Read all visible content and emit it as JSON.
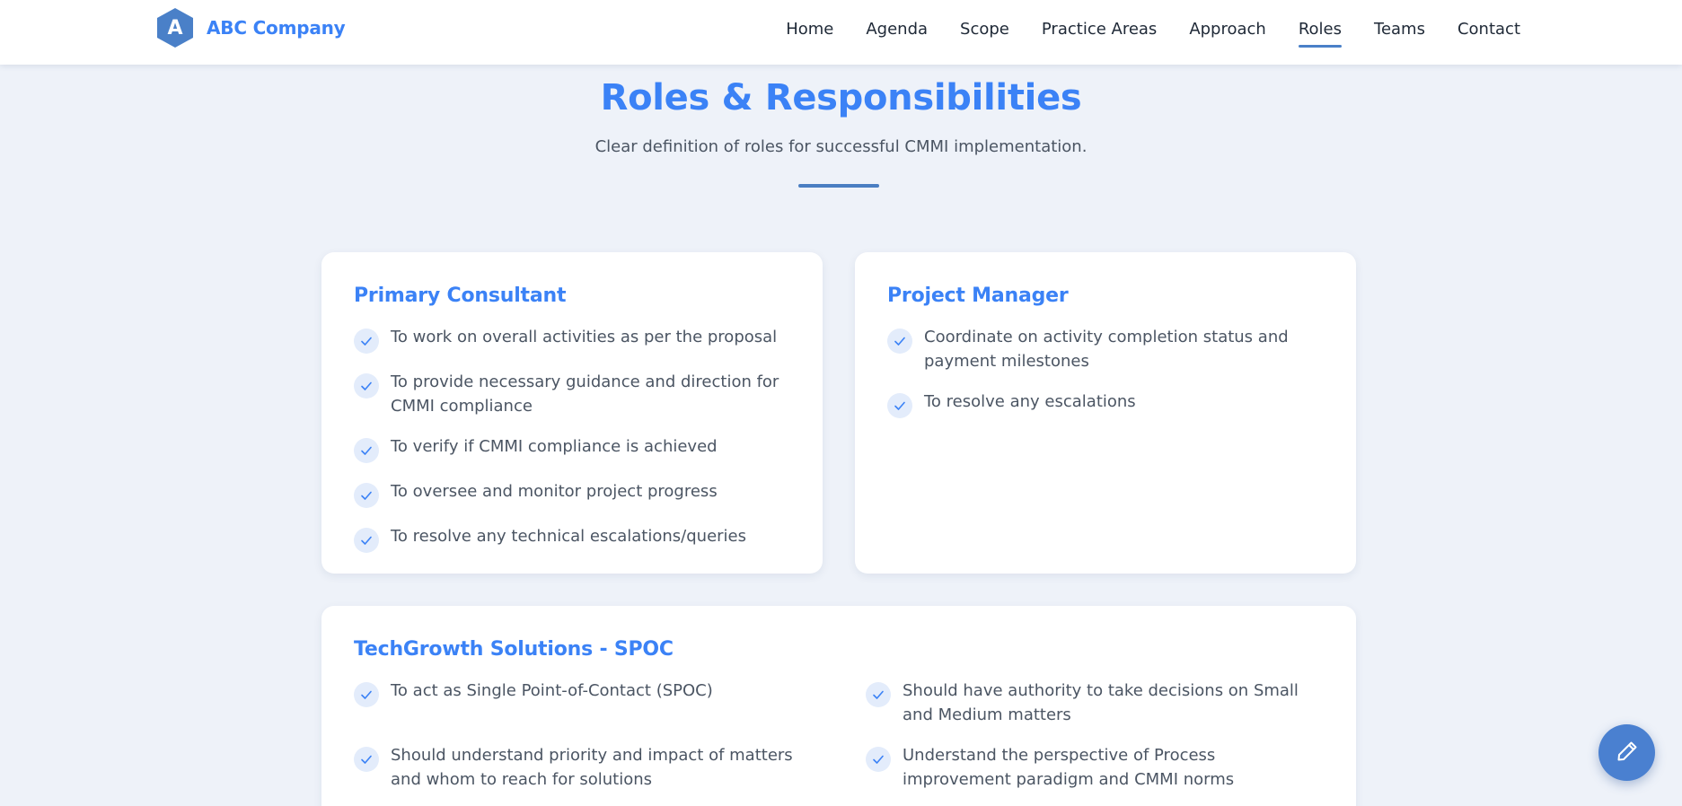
{
  "brand": {
    "letter": "A",
    "name": "ABC Company"
  },
  "nav": {
    "items": [
      {
        "label": "Home",
        "active": false
      },
      {
        "label": "Agenda",
        "active": false
      },
      {
        "label": "Scope",
        "active": false
      },
      {
        "label": "Practice Areas",
        "active": false
      },
      {
        "label": "Approach",
        "active": false
      },
      {
        "label": "Roles",
        "active": true
      },
      {
        "label": "Teams",
        "active": false
      },
      {
        "label": "Contact",
        "active": false
      }
    ]
  },
  "section": {
    "title": "Roles & Responsibilities",
    "subtitle": "Clear definition of roles for successful CMMI implementation."
  },
  "cards": {
    "primary_consultant": {
      "title": "Primary Consultant",
      "items": [
        "To work on overall activities as per the proposal",
        "To provide necessary guidance and direction for CMMI compliance",
        "To verify if CMMI compliance is achieved",
        "To oversee and monitor project progress",
        "To resolve any technical escalations/queries"
      ]
    },
    "project_manager": {
      "title": "Project Manager",
      "items": [
        "Coordinate on activity completion status and payment milestones",
        "To resolve any escalations"
      ]
    },
    "spoc": {
      "title": "TechGrowth Solutions - SPOC",
      "items": [
        "To act as Single Point-of-Contact (SPOC)",
        "Should have authority to take decisions on Small and Medium matters",
        "Should understand priority and impact of matters and whom to reach for solutions",
        "Understand the perspective of Process improvement paradigm and CMMI norms"
      ]
    }
  },
  "icons": {
    "check": "check-icon",
    "fab": "pencil-icon"
  },
  "colors": {
    "accent": "#3b82f6",
    "accent_dark": "#4a80c8",
    "background": "#eef2f9",
    "check_bg": "#e3ecfb"
  }
}
